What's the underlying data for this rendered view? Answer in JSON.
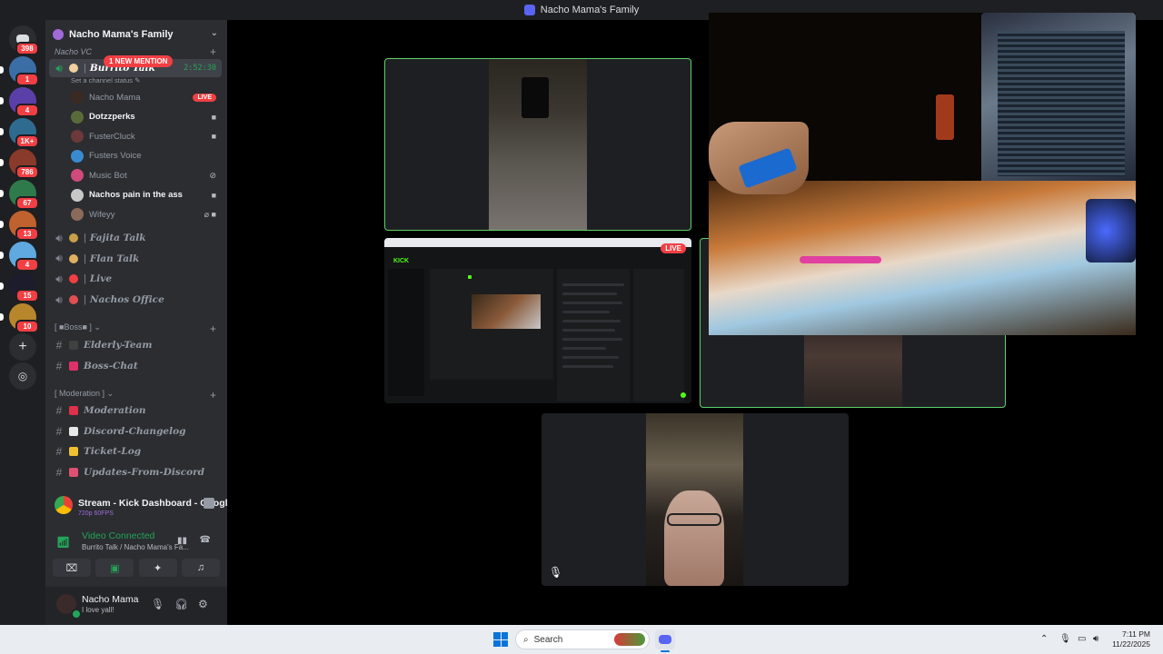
{
  "window": {
    "title": "Nacho Mama's Family"
  },
  "rail": {
    "home_badge": "398",
    "servers": [
      {
        "name": "server-1",
        "badge": "1",
        "color": "#3a6ea5"
      },
      {
        "name": "server-2",
        "badge": "4",
        "color": "#5b3fa8"
      },
      {
        "name": "server-3",
        "badge": "1K+",
        "color": "#2e6b8f"
      },
      {
        "name": "server-4",
        "badge": "786",
        "color": "#8a3a2a"
      },
      {
        "name": "server-5",
        "badge": "67",
        "color": "#2f7a4a"
      },
      {
        "name": "server-6",
        "badge": "13",
        "color": "#c0622f"
      },
      {
        "name": "server-7",
        "badge": "4",
        "color": "#5fa9e0"
      },
      {
        "name": "server-8",
        "badge": "15",
        "color": "#1c1c2c"
      },
      {
        "name": "server-9",
        "badge": "10",
        "color": "#b8862b"
      }
    ]
  },
  "sidebar": {
    "guild_name": "Nacho Mama's Family",
    "voice_category": "Nacho VC",
    "new_mention": "1 NEW MENTION",
    "active_channel": {
      "name": "Burrito Talk",
      "timer": "2:52:30",
      "status": "Set a channel status"
    },
    "members": [
      {
        "name": "Nacho Mama",
        "live": "LIVE",
        "color": "#3b2a22",
        "bright": false
      },
      {
        "name": "Dotzzperks",
        "color": "#5a6b3a",
        "bright": true,
        "icon": "camera-icon"
      },
      {
        "name": "FusterCluck",
        "color": "#6b3a3a",
        "bright": false,
        "icon": "camera-icon"
      },
      {
        "name": "Fusters Voice",
        "color": "#3a8ad0",
        "bright": false
      },
      {
        "name": "Music Bot",
        "color": "#d04a7a",
        "bright": false,
        "icon": "deafen-icon"
      },
      {
        "name": "Nachos pain in the ass",
        "color": "#c8c8c8",
        "bright": true,
        "icon": "camera-icon"
      },
      {
        "name": "Wifeyy",
        "color": "#8a6a5a",
        "bright": false,
        "icon": "muted-camera-icon"
      }
    ],
    "voice_channels": [
      {
        "name": "Fajita Talk",
        "emoji": "#c8a04a"
      },
      {
        "name": "Flan Talk",
        "emoji": "#e0b060"
      },
      {
        "name": "Live",
        "emoji": "#f23f43"
      },
      {
        "name": "Nachos Office",
        "emoji": "#e05050"
      }
    ],
    "boss_category": "Boss",
    "boss_channels": [
      {
        "name": "Elderly-Team",
        "emoji": "#404040"
      },
      {
        "name": "Boss-Chat",
        "emoji": "#e0306a"
      }
    ],
    "mod_category": "Moderation",
    "mod_channels": [
      {
        "name": "Moderation",
        "emoji": "#e0304a"
      },
      {
        "name": "Discord-Changelog",
        "emoji": "#e8e8e8"
      },
      {
        "name": "Ticket-Log",
        "emoji": "#f0c030"
      },
      {
        "name": "Updates-From-Discord",
        "emoji": "#e05070"
      }
    ]
  },
  "voice_panel": {
    "stream_title": "Stream - Kick Dashboard - Google ...",
    "stream_quality": "720p 60FPS",
    "status": "Video Connected",
    "channel_path": "Burrito Talk / Nacho Mama's Fa...",
    "buttons": [
      "camera-off-icon",
      "screen-share-icon",
      "activities-icon",
      "soundboard-icon"
    ]
  },
  "user": {
    "name": "Nacho Mama",
    "status": "I love yall!"
  },
  "stage": {
    "live_label": "LIVE",
    "kick_logo": "KICK"
  },
  "taskbar": {
    "search_placeholder": "Search",
    "time": "7:11 PM",
    "date": "11/22/2025"
  }
}
